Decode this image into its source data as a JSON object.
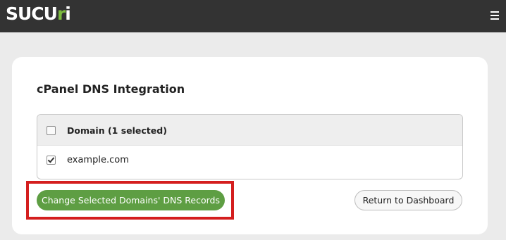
{
  "header": {
    "logo_text_white": "SUCU",
    "logo_text_green": "r",
    "logo_text_end": "i",
    "menu_icon": "hamburger-menu-icon"
  },
  "card": {
    "title": "cPanel DNS Integration",
    "table": {
      "header_checkbox_checked": false,
      "header_label": "Domain (1 selected)",
      "rows": [
        {
          "label": "example.com",
          "checked": true
        }
      ]
    },
    "primary_button_label": "Change Selected Domains' DNS Records",
    "secondary_button_label": "Return to Dashboard"
  },
  "colors": {
    "topbar": "#333333",
    "brand_green": "#7cbb3e",
    "primary_button": "#5e9e43",
    "highlight_border": "#d41e1e"
  }
}
